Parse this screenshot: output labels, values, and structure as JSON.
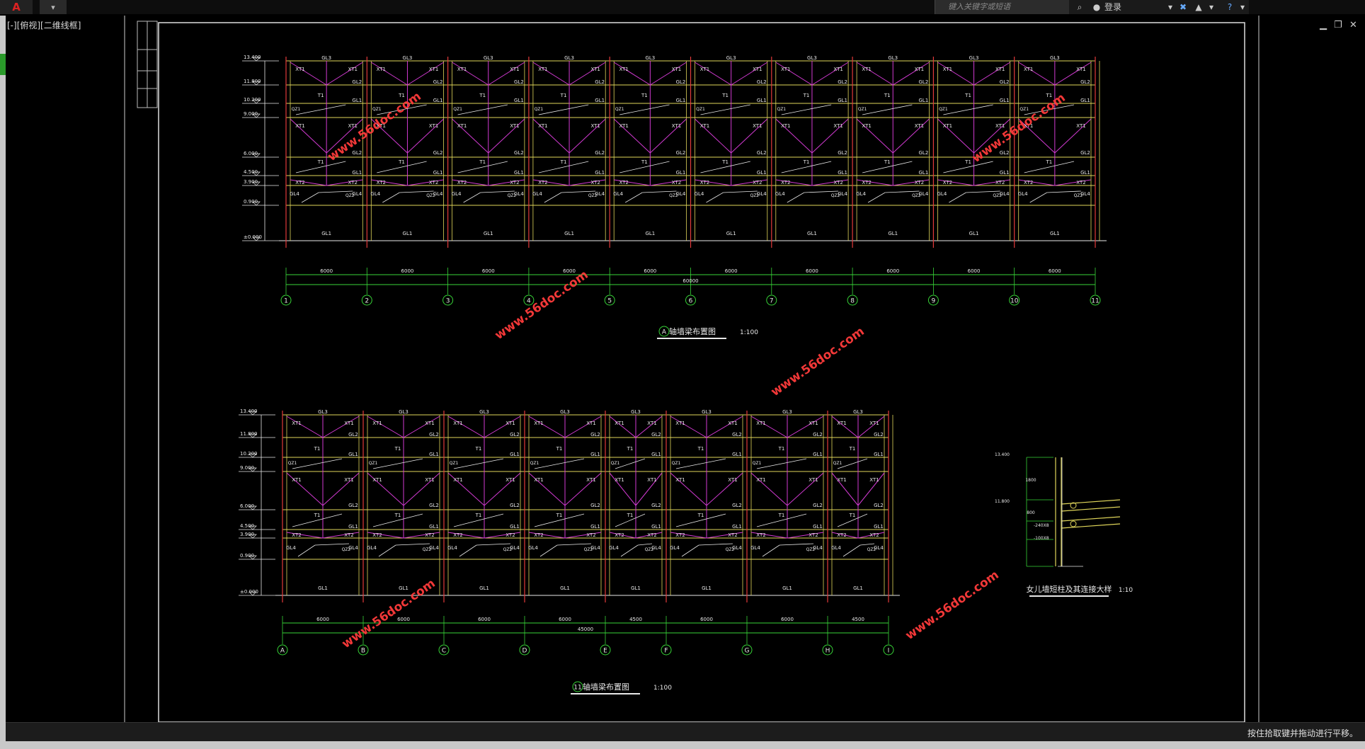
{
  "titlebar": {
    "app_icon": "A",
    "quick_access": "▾",
    "search_placeholder": "键入关键字或短语",
    "login_label": "登录"
  },
  "viewport": {
    "label": "[-][俯视][二维线框]"
  },
  "drawing": {
    "elevation_a": {
      "title": "轴墙梁布置图",
      "axis_letter": "A",
      "scale": "1:100",
      "levels": [
        "13.400",
        "11.800",
        "10.200",
        "9.000",
        "6.000",
        "4.500",
        "3.900",
        "0.900",
        "±0.000"
      ],
      "bay_dims": [
        "6000",
        "6000",
        "6000",
        "6000",
        "6000",
        "6000",
        "6000",
        "6000",
        "6000",
        "6000"
      ],
      "total_dim": "60000",
      "axes": [
        "1",
        "2",
        "3",
        "4",
        "5",
        "6",
        "7",
        "8",
        "9",
        "10",
        "11"
      ]
    },
    "elevation_11": {
      "title": "轴墙梁布置图",
      "axis_number": "11",
      "scale": "1:100",
      "levels": [
        "13.400",
        "11.800",
        "10.200",
        "9.000",
        "6.000",
        "4.500",
        "3.900",
        "0.900",
        "±0.000"
      ],
      "bay_dims": [
        "6000",
        "6000",
        "6000",
        "6000",
        "4500",
        "6000",
        "6000",
        "4500"
      ],
      "total_dim": "45000",
      "axes": [
        "A",
        "B",
        "C",
        "D",
        "E",
        "F",
        "G",
        "H",
        "I"
      ]
    },
    "detail": {
      "title": "女儿墙短柱及其连接大样",
      "scale": "1:10",
      "levels": [
        "13.400",
        "11.800"
      ],
      "dim_1800": "1800",
      "dim_800": "800",
      "dim_c": "-100X8",
      "dim_d": "-240X8"
    },
    "labels": {
      "gl1": "GL1",
      "gl2": "GL2",
      "gl3": "GL3",
      "gl4": "GL4",
      "xt1": "XT1",
      "xt2": "XT2",
      "t1": "T1",
      "qz1": "QZ1",
      "qz2": "QZ2"
    },
    "watermark": "www.56doc.com"
  },
  "status": {
    "text": "按住拾取键并拖动进行平移。"
  }
}
